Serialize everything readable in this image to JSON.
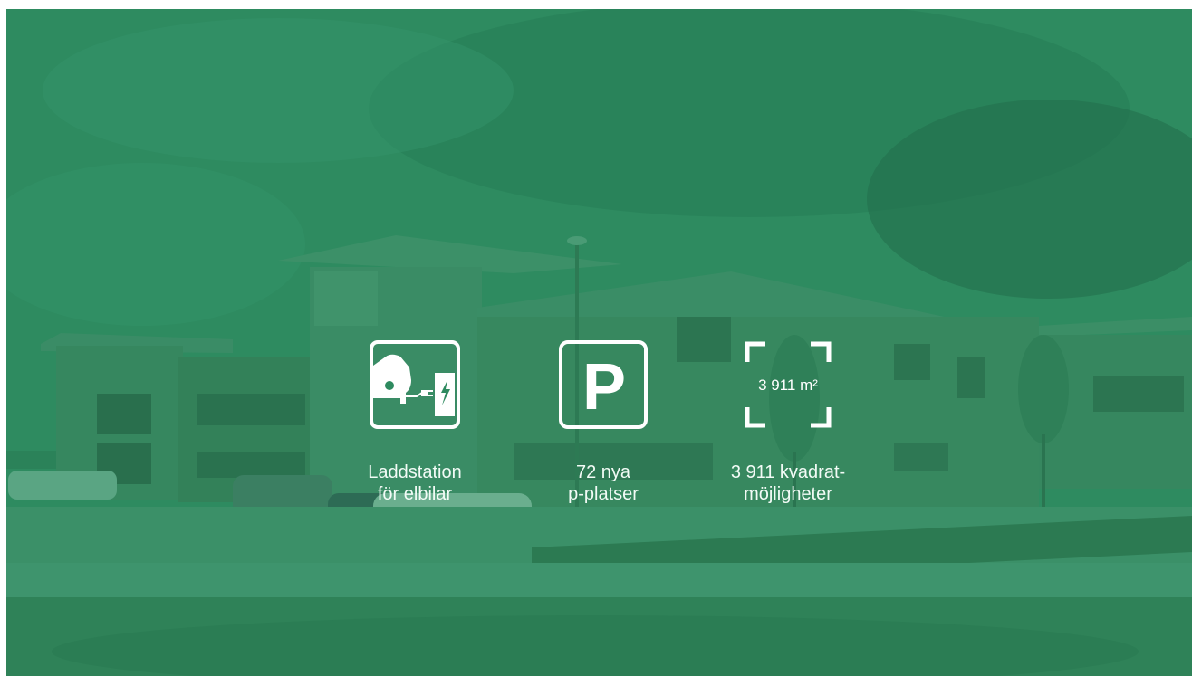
{
  "features": [
    {
      "icon": "ev-charging-icon",
      "line1": "Laddstation",
      "line2": "för elbilar"
    },
    {
      "icon": "parking-icon",
      "glyph": "P",
      "line1": "72 nya",
      "line2": "p-platser"
    },
    {
      "icon": "area-frame-icon",
      "area_value": "3 911 m²",
      "line1": "3 911 kvadrat-",
      "line2": "möjligheter"
    }
  ],
  "colors": {
    "overlay": "#2e8a5f",
    "text": "#ffffff"
  }
}
